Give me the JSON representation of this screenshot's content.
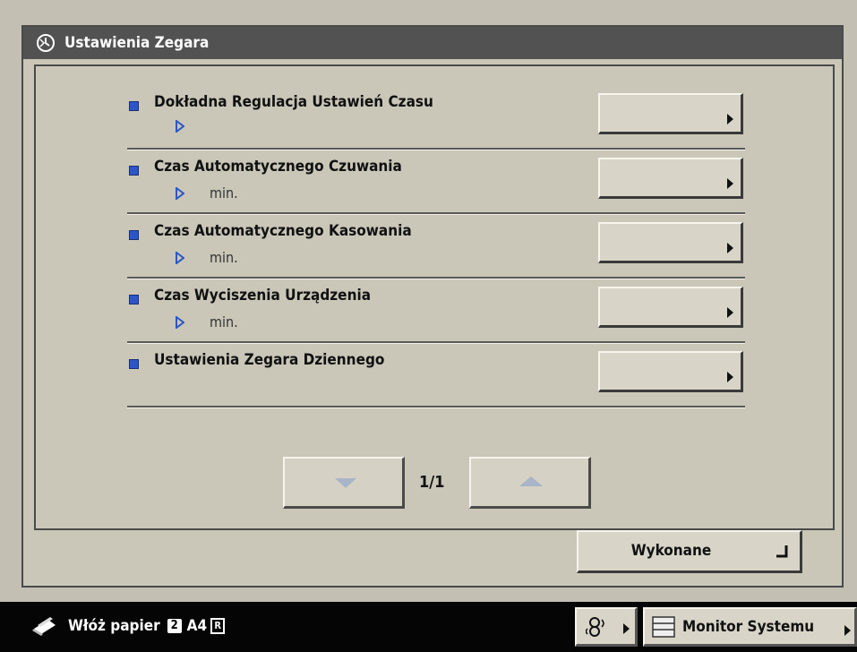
{
  "window": {
    "title": "Ustawienia Zegara"
  },
  "settings": [
    {
      "label": "Dokładna Regulacja Ustawień Czasu",
      "sub": ""
    },
    {
      "label": "Czas Automatycznego Czuwania",
      "sub": "min."
    },
    {
      "label": "Czas Automatycznego Kasowania",
      "sub": "min."
    },
    {
      "label": "Czas Wyciszenia Urządzenia",
      "sub": "min."
    },
    {
      "label": "Ustawienia Zegara Dziennego",
      "sub": ""
    }
  ],
  "pager": {
    "text": "1/1"
  },
  "done_button": {
    "label": "Wykonane"
  },
  "statusbar": {
    "message": "Włóż papier",
    "tray": "2",
    "paper": "A4",
    "paper_orientation": "R",
    "monitor_label": "Monitor Systemu"
  },
  "colors": {
    "accent": "#2b55c8",
    "titlebar": "#525252",
    "panel": "#cac7b9",
    "status": "#050505"
  },
  "icons": {
    "title": "clock-settings-icon",
    "status": "paper-icon",
    "network": "network-icon",
    "monitor": "monitor-icon"
  }
}
